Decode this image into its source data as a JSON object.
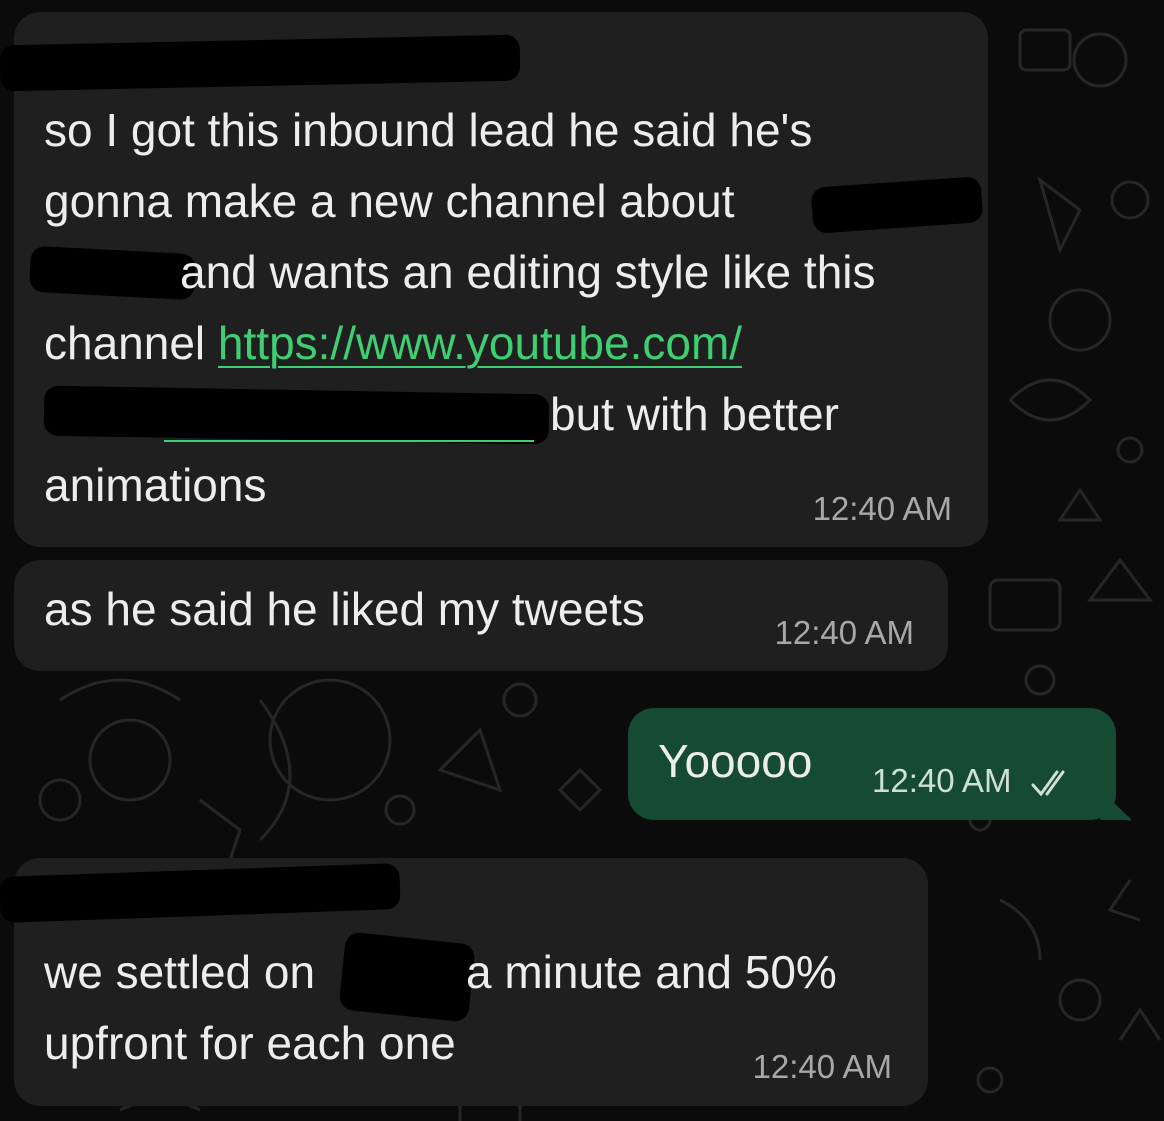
{
  "chat": {
    "messages": [
      {
        "direction": "incoming",
        "lines": [
          "so I got this inbound lead he said he's",
          "gonna make a new channel about",
          "and wants an editing style like this",
          "channel",
          "but with better",
          "animations"
        ],
        "link_text": "https://www.youtube.com/",
        "time": "12:40 AM"
      },
      {
        "direction": "incoming",
        "text": "as he said he liked my tweets",
        "time": "12:40 AM"
      },
      {
        "direction": "outgoing",
        "text": "Yooooo",
        "time": "12:40 AM",
        "status": "read-double-check-icon"
      },
      {
        "direction": "incoming",
        "lines": [
          "we settled on",
          "a minute and 50%",
          "upfront for each one"
        ],
        "time": "12:40 AM"
      }
    ]
  },
  "colors": {
    "background": "#0b0b0b",
    "incoming_bubble": "#1f1f1f",
    "outgoing_bubble": "#154b32",
    "link": "#3fcf73",
    "read_ticks": "#cfe0d6"
  }
}
